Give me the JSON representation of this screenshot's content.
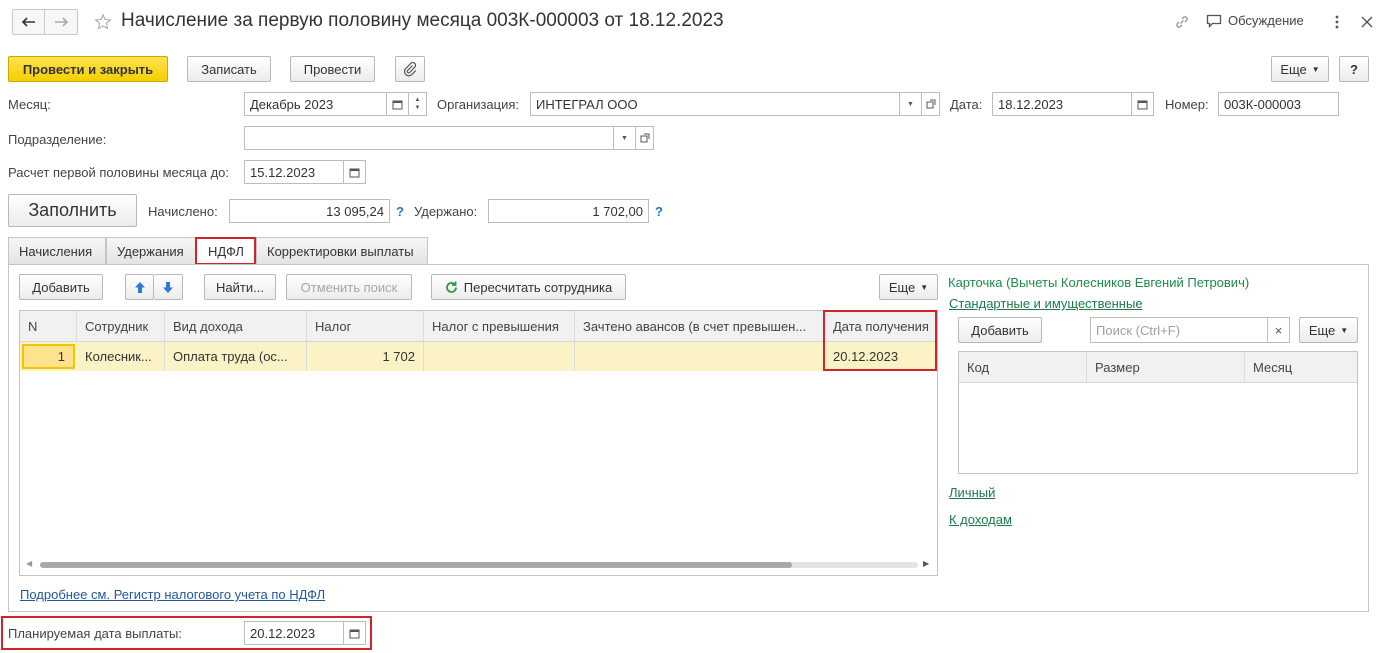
{
  "window": {
    "title": "Начисление за первую половину месяца 003К-000003 от 18.12.2023",
    "discussion_label": "Обсуждение"
  },
  "toolbar": {
    "post_close": "Провести и закрыть",
    "save": "Записать",
    "post": "Провести",
    "more": "Еще",
    "help": "?"
  },
  "header": {
    "month_label": "Месяц:",
    "month_value": "Декабрь 2023",
    "org_label": "Организация:",
    "org_value": "ИНТЕГРАЛ ООО",
    "date_label": "Дата:",
    "date_value": "18.12.2023",
    "number_label": "Номер:",
    "number_value": "003К-000003",
    "dept_label": "Подразделение:",
    "dept_value": "",
    "calc_label": "Расчет первой половины месяца до:",
    "calc_value": "15.12.2023",
    "fill_button": "Заполнить",
    "accrued_label": "Начислено:",
    "accrued_value": "13 095,24",
    "withheld_label": "Удержано:",
    "withheld_value": "1 702,00",
    "hint": "?"
  },
  "tabs": [
    {
      "label": "Начисления"
    },
    {
      "label": "Удержания"
    },
    {
      "label": "НДФЛ"
    },
    {
      "label": "Корректировки выплаты"
    }
  ],
  "ndfl": {
    "add_button": "Добавить",
    "find_button": "Найти...",
    "cancel_search_button": "Отменить поиск",
    "recalc_button": "Пересчитать сотрудника",
    "more_button": "Еще",
    "columns": [
      "N",
      "Сотрудник",
      "Вид дохода",
      "Налог",
      "Налог с превышения",
      "Зачтено авансов (в счет превышен...",
      "Дата получения"
    ],
    "rows": [
      [
        "1",
        "Колесник...",
        "Оплата труда (ос...",
        "1 702",
        "",
        "",
        "20.12.2023"
      ]
    ],
    "register_link": "Подробнее см. Регистр налогового учета по НДФЛ"
  },
  "card": {
    "title": "Карточка (Вычеты Колесников Евгений Петрович)",
    "standard_link": "Стандартные и имущественные",
    "add_button": "Добавить",
    "search_placeholder": "Поиск (Ctrl+F)",
    "clear": "×",
    "more_button": "Еще",
    "columns": [
      "Код",
      "Размер",
      "Месяц"
    ],
    "personal_link": "Личный",
    "income_link": "К доходам"
  },
  "footer": {
    "planned_label": "Планируемая дата выплаты:",
    "planned_value": "20.12.2023"
  }
}
